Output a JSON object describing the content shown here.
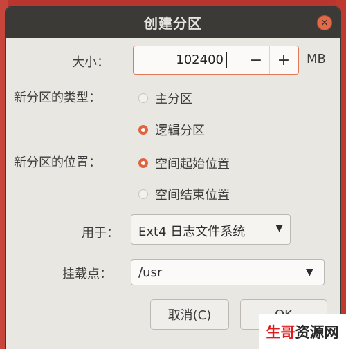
{
  "window": {
    "title": "创建分区",
    "close_icon": "×"
  },
  "size": {
    "label": "大小：",
    "value": "102400",
    "unit": "MB",
    "minus": "−",
    "plus": "+"
  },
  "partition_type": {
    "label": "新分区的类型：",
    "options": [
      {
        "label": "主分区",
        "selected": false
      },
      {
        "label": "逻辑分区",
        "selected": true
      }
    ]
  },
  "partition_location": {
    "label": "新分区的位置：",
    "options": [
      {
        "label": "空间起始位置",
        "selected": true
      },
      {
        "label": "空间结束位置",
        "selected": false
      }
    ]
  },
  "use_as": {
    "label": "用于：",
    "value": "Ext4 日志文件系统",
    "arrow": "▼"
  },
  "mount_point": {
    "label": "挂载点：",
    "value": "/usr",
    "arrow": "▼"
  },
  "buttons": {
    "cancel": "取消(C)",
    "ok": "OK"
  },
  "watermark": {
    "part1": "生哥",
    "part2": "资源网"
  },
  "colors": {
    "accent": "#e0643f",
    "titlebar": "#3b3a37",
    "background": "#e9e7e1"
  }
}
